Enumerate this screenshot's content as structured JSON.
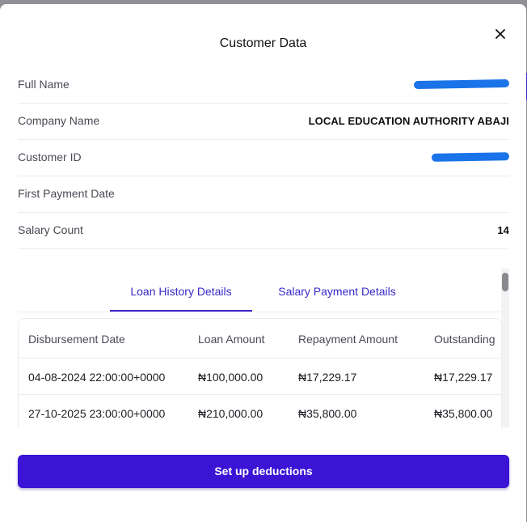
{
  "modal": {
    "title": "Customer Data",
    "close_icon": "close-icon"
  },
  "customer": {
    "rows": [
      {
        "label": "Full Name",
        "value": "",
        "redacted": true
      },
      {
        "label": "Company Name",
        "value": "LOCAL EDUCATION AUTHORITY ABAJI",
        "redacted": false
      },
      {
        "label": "Customer ID",
        "value": "",
        "redacted": true
      },
      {
        "label": "First Payment Date",
        "value": "",
        "redacted": false
      },
      {
        "label": "Salary Count",
        "value": "14",
        "redacted": false
      }
    ],
    "redaction_color": "#1a73e8"
  },
  "tabs": {
    "items": [
      {
        "label": "Loan History Details",
        "active": true
      },
      {
        "label": "Salary Payment Details",
        "active": false
      }
    ],
    "accent_color": "#3b28c9"
  },
  "loan_table": {
    "columns": [
      "Disbursement Date",
      "Loan Amount",
      "Repayment Amount",
      "Outstanding"
    ],
    "rows": [
      [
        "04-08-2024 22:00:00+0000",
        "₦100,000.00",
        "₦17,229.17",
        "₦17,229.17"
      ],
      [
        "27-10-2025 23:00:00+0000",
        "₦210,000.00",
        "₦35,800.00",
        "₦35,800.00"
      ]
    ]
  },
  "actions": {
    "primary_label": "Set up deductions",
    "primary_color": "#3b14d6"
  }
}
